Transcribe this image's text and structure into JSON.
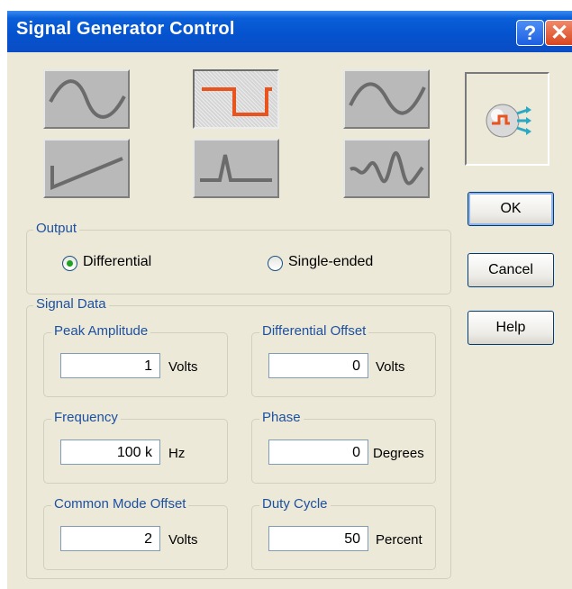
{
  "window": {
    "title": "Signal Generator Control"
  },
  "titlebar": {
    "help_icon": "question-mark-icon",
    "help_label": "?",
    "close_icon": "close-x-icon",
    "close_label": "✕"
  },
  "waveforms": [
    {
      "name": "sine",
      "selected": false
    },
    {
      "name": "square",
      "selected": true,
      "color": "#e8531e"
    },
    {
      "name": "sine-alt",
      "selected": false
    },
    {
      "name": "sawtooth",
      "selected": false
    },
    {
      "name": "pulse",
      "selected": false
    },
    {
      "name": "arbitrary",
      "selected": false
    }
  ],
  "preview": {
    "icon": "signal-source-icon"
  },
  "buttons": {
    "ok": "OK",
    "cancel": "Cancel",
    "help": "Help"
  },
  "output": {
    "label": "Output",
    "options": [
      {
        "label": "Differential",
        "selected": true
      },
      {
        "label": "Single-ended",
        "selected": false
      }
    ]
  },
  "signal_data": {
    "label": "Signal Data",
    "peak_amplitude": {
      "label": "Peak Amplitude",
      "value": "1",
      "unit": "Volts"
    },
    "differential_offset": {
      "label": "Differential Offset",
      "value": "0",
      "unit": "Volts"
    },
    "frequency": {
      "label": "Frequency",
      "value": "100 k",
      "unit": "Hz"
    },
    "phase": {
      "label": "Phase",
      "value": "0",
      "unit": "Degrees"
    },
    "common_mode_offset": {
      "label": "Common Mode Offset",
      "value": "2",
      "unit": "Volts"
    },
    "duty_cycle": {
      "label": "Duty Cycle",
      "value": "50",
      "unit": "Percent"
    }
  },
  "colors": {
    "title_bar": "#0553cf",
    "group_label": "#1e50a0",
    "accent_wave": "#e8531e",
    "radio_dot": "#21a121"
  }
}
